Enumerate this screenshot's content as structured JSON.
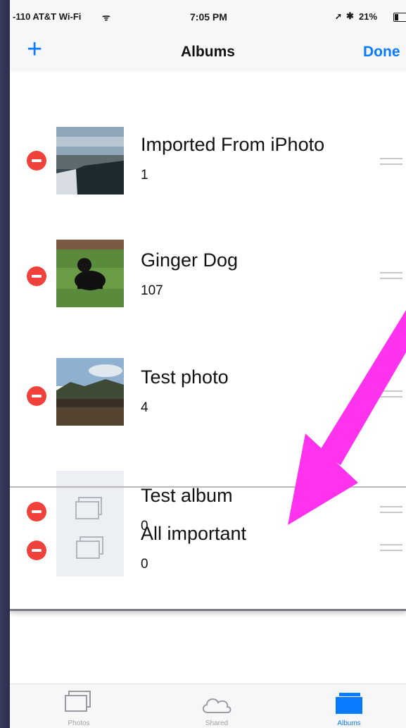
{
  "status": {
    "carrier": "-110 AT&T Wi-Fi",
    "time": "7:05 PM",
    "right": "21%",
    "bluetooth": "✱"
  },
  "nav": {
    "add_label": "+",
    "title": "Albums",
    "done_label": "Done"
  },
  "albums": [
    {
      "title": "Imported From iPhoto",
      "count": "1"
    },
    {
      "title": "Ginger Dog",
      "count": "107"
    },
    {
      "title": "Test photo",
      "count": "4"
    },
    {
      "title": "Test album",
      "count": "0"
    },
    {
      "title": "All important",
      "count": "0"
    }
  ],
  "tabs": [
    {
      "label": "Photos",
      "icon": "photos-stack-icon"
    },
    {
      "label": "Shared",
      "icon": "cloud-icon"
    },
    {
      "label": "Albums",
      "icon": "albums-icon"
    }
  ],
  "colors": {
    "accent": "#0a7aff",
    "delete": "#f0413b",
    "annotation_arrow": "#ff33ee"
  }
}
